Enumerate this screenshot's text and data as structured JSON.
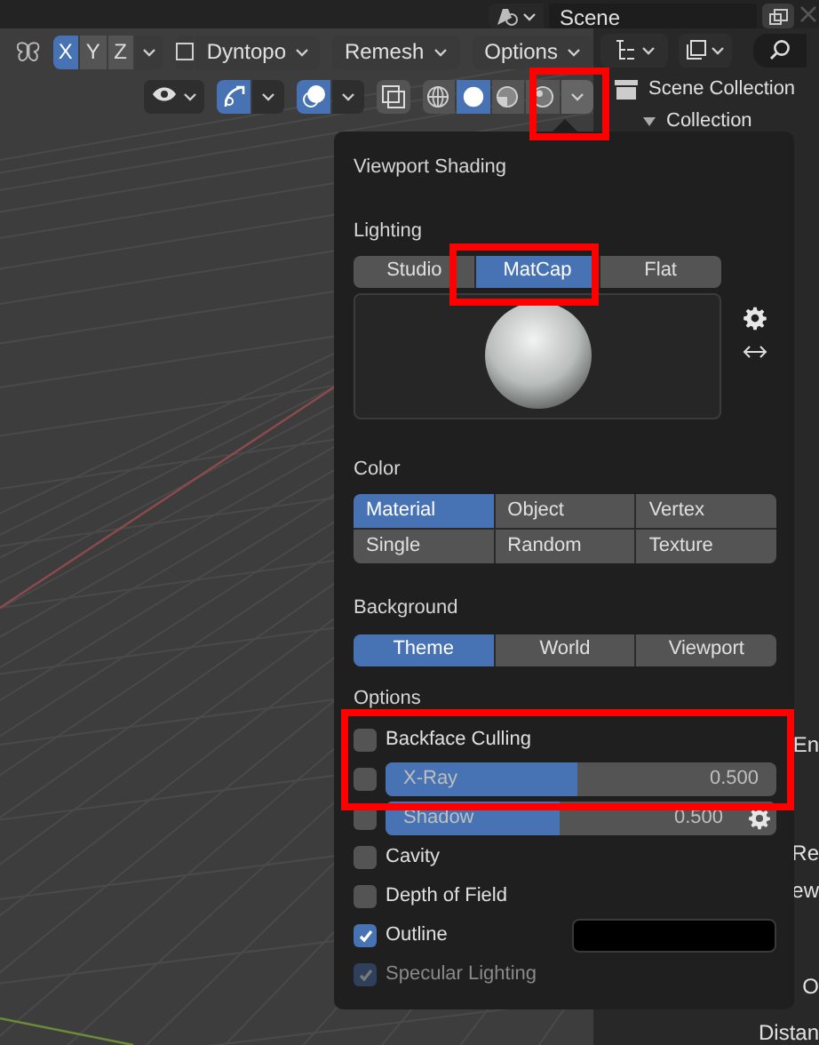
{
  "header": {
    "scene_field": "Scene"
  },
  "toolbar": {
    "axes": [
      {
        "label": "X",
        "selected": true
      },
      {
        "label": "Y",
        "selected": false
      },
      {
        "label": "Z",
        "selected": false
      }
    ],
    "dyntopo": {
      "label": "Dyntopo",
      "checked": false
    },
    "menus": [
      "Remesh",
      "Options"
    ]
  },
  "viewport_header": {
    "snap_on": true,
    "overlay_on": true,
    "xray_on": false,
    "shading_modes": [
      {
        "kind": "wireframe",
        "selected": false
      },
      {
        "kind": "solid",
        "selected": true
      },
      {
        "kind": "material",
        "selected": false
      },
      {
        "kind": "rendered",
        "selected": false
      }
    ]
  },
  "outliner": {
    "items": [
      "Scene Collection",
      "Collection"
    ]
  },
  "properties": {
    "fragments": [
      "En",
      "Re",
      "ew",
      "O",
      "Distan"
    ]
  },
  "popup": {
    "title": "Viewport Shading",
    "lighting": {
      "label": "Lighting",
      "options": [
        {
          "label": "Studio",
          "selected": false
        },
        {
          "label": "MatCap",
          "selected": true
        },
        {
          "label": "Flat",
          "selected": false
        }
      ]
    },
    "color": {
      "label": "Color",
      "options": [
        {
          "label": "Material",
          "selected": true
        },
        {
          "label": "Object",
          "selected": false
        },
        {
          "label": "Vertex",
          "selected": false
        },
        {
          "label": "Single",
          "selected": false
        },
        {
          "label": "Random",
          "selected": false
        },
        {
          "label": "Texture",
          "selected": false
        }
      ]
    },
    "background": {
      "label": "Background",
      "options": [
        {
          "label": "Theme",
          "selected": true
        },
        {
          "label": "World",
          "selected": false
        },
        {
          "label": "Viewport",
          "selected": false
        }
      ]
    },
    "options": {
      "label": "Options",
      "rows": [
        {
          "kind": "checkbox",
          "label": "Backface Culling",
          "checked": false,
          "disabled": false
        },
        {
          "kind": "slider",
          "label": "X-Ray",
          "checked": false,
          "disabled": false,
          "level": 0.49,
          "reading": "0.500"
        },
        {
          "kind": "slider_gear",
          "label": "Shadow",
          "checked": false,
          "disabled": false,
          "level": 0.49,
          "reading": "0.500"
        },
        {
          "kind": "checkbox",
          "label": "Cavity",
          "checked": false,
          "disabled": false
        },
        {
          "kind": "checkbox",
          "label": "Depth of Field",
          "checked": false,
          "disabled": false
        },
        {
          "kind": "swatch",
          "label": "Outline",
          "checked": true,
          "disabled": false
        },
        {
          "kind": "checkbox",
          "label": "Specular Lighting",
          "checked": true,
          "disabled": true
        }
      ]
    }
  }
}
